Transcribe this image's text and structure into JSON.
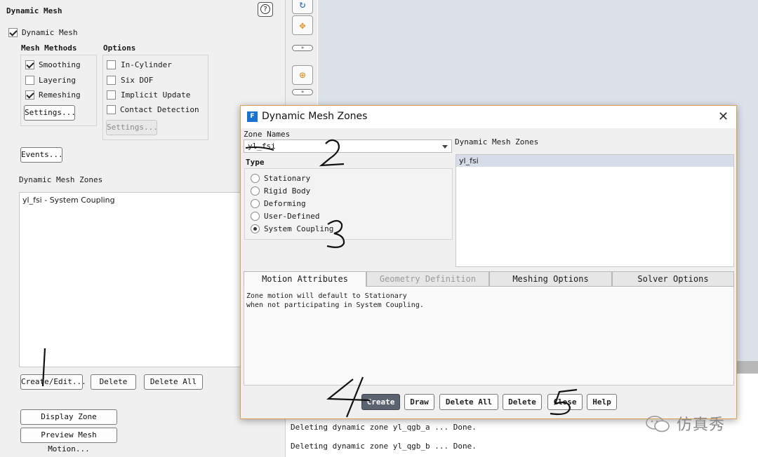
{
  "left_panel": {
    "title": "Dynamic Mesh",
    "dynamic_mesh_checkbox": {
      "label": "Dynamic Mesh",
      "checked": true
    },
    "mesh_methods": {
      "heading": "Mesh Methods",
      "items": [
        {
          "label": "Smoothing",
          "checked": true
        },
        {
          "label": "Layering",
          "checked": false
        },
        {
          "label": "Remeshing",
          "checked": true
        }
      ],
      "settings_label": "Settings..."
    },
    "options": {
      "heading": "Options",
      "items": [
        {
          "label": "In-Cylinder",
          "checked": false
        },
        {
          "label": "Six DOF",
          "checked": false
        },
        {
          "label": "Implicit Update",
          "checked": false
        },
        {
          "label": "Contact Detection",
          "checked": false
        }
      ],
      "settings_label": "Settings..."
    },
    "events_label": "Events...",
    "zones_heading": "Dynamic Mesh Zones",
    "zones_list": [
      "yl_fsi - System Coupling"
    ],
    "create_edit_label": "Create/Edit...",
    "delete_label": "Delete",
    "delete_all_label": "Delete All",
    "display_zone_motion_label": "Display Zone Motion...",
    "preview_mesh_motion_label": "Preview Mesh Motion..."
  },
  "dialog": {
    "title": "Dynamic Mesh Zones",
    "app_icon_letter": "F",
    "zone_names_label": "Zone Names",
    "zone_name_value": "yl_fsi",
    "type_label": "Type",
    "types": [
      {
        "label": "Stationary",
        "checked": false
      },
      {
        "label": "Rigid Body",
        "checked": false
      },
      {
        "label": "Deforming",
        "checked": false
      },
      {
        "label": "User-Defined",
        "checked": false
      },
      {
        "label": "System Coupling",
        "checked": true
      }
    ],
    "zones_label": "Dynamic Mesh Zones",
    "zones_list": [
      "yl_fsi"
    ],
    "tabs": [
      {
        "label": "Motion Attributes",
        "state": "active"
      },
      {
        "label": "Geometry Definition",
        "state": "disabled"
      },
      {
        "label": "Meshing Options",
        "state": "normal"
      },
      {
        "label": "Solver Options",
        "state": "normal"
      }
    ],
    "motion_text_line1": "Zone motion will default to Stationary",
    "motion_text_line2": "when not participating in System Coupling.",
    "buttons": {
      "create": "Create",
      "draw": "Draw",
      "delete_all": "Delete All",
      "delete": "Delete",
      "close": "Close",
      "help": "Help"
    }
  },
  "console": {
    "lines": [
      "Deleting dynamic zone yl_qgb_a ... Done.",
      "Deleting dynamic zone yl_qgb_b ... Done."
    ]
  },
  "annotations": [
    "1",
    "2",
    "3",
    "4",
    "5"
  ],
  "watermark": {
    "text": "仿真秀"
  },
  "icons": {
    "help": "help-circle-icon",
    "rotate": "rotate-icon",
    "pan": "pan-icon",
    "zoom": "zoom-icon",
    "close": "close-icon"
  }
}
